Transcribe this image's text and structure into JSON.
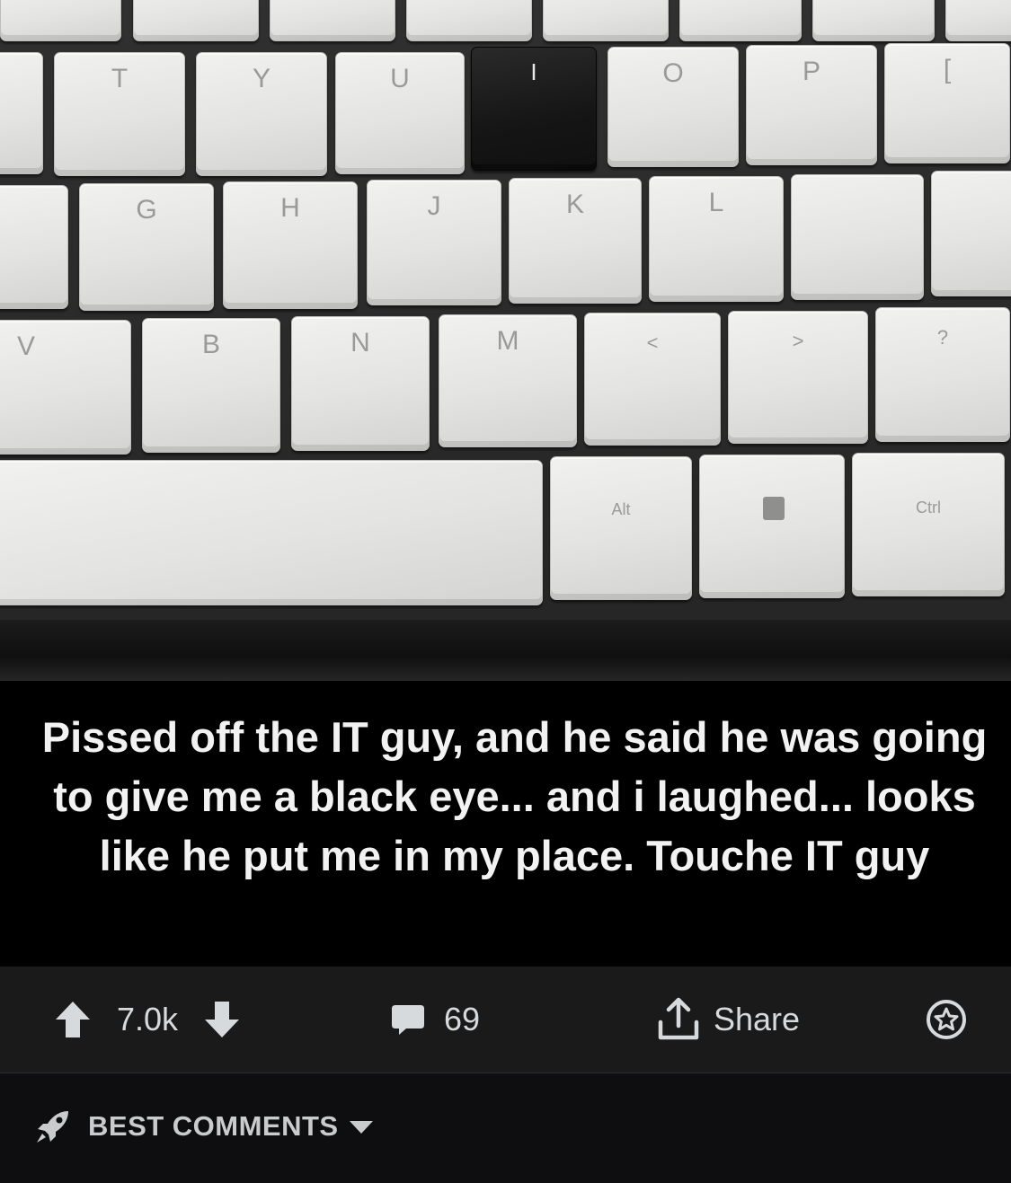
{
  "post": {
    "image": {
      "keys": {
        "row0": [],
        "row1": [
          "T",
          "Y",
          "U",
          "I",
          "O",
          "P",
          "["
        ],
        "row2": [
          "G",
          "H",
          "J",
          "K",
          "L",
          "",
          ""
        ],
        "row3": [
          "V",
          "B",
          "N",
          "M",
          "<",
          ">",
          "?"
        ],
        "row4": [
          "",
          "Alt",
          "",
          "Ctrl"
        ]
      }
    },
    "caption": "Pissed off the IT guy, and he said he was going to give me a black eye... and i laughed... looks like he put me in my place. Touche IT guy"
  },
  "actions": {
    "upvote_icon": "arrow-up-icon",
    "vote_count": "7.0k",
    "downvote_icon": "arrow-down-icon",
    "comment_icon": "comment-bubble-icon",
    "comment_count": "69",
    "share_icon": "share-upload-icon",
    "share_label": "Share",
    "award_icon": "award-star-icon"
  },
  "sort": {
    "icon": "rocket-icon",
    "label": "BEST COMMENTS",
    "chevron_icon": "caret-down-icon"
  },
  "colors": {
    "background": "#0e0e10",
    "action_bar": "#1a1a1b",
    "text": "#d7dadc",
    "caption_bg": "#000000"
  }
}
